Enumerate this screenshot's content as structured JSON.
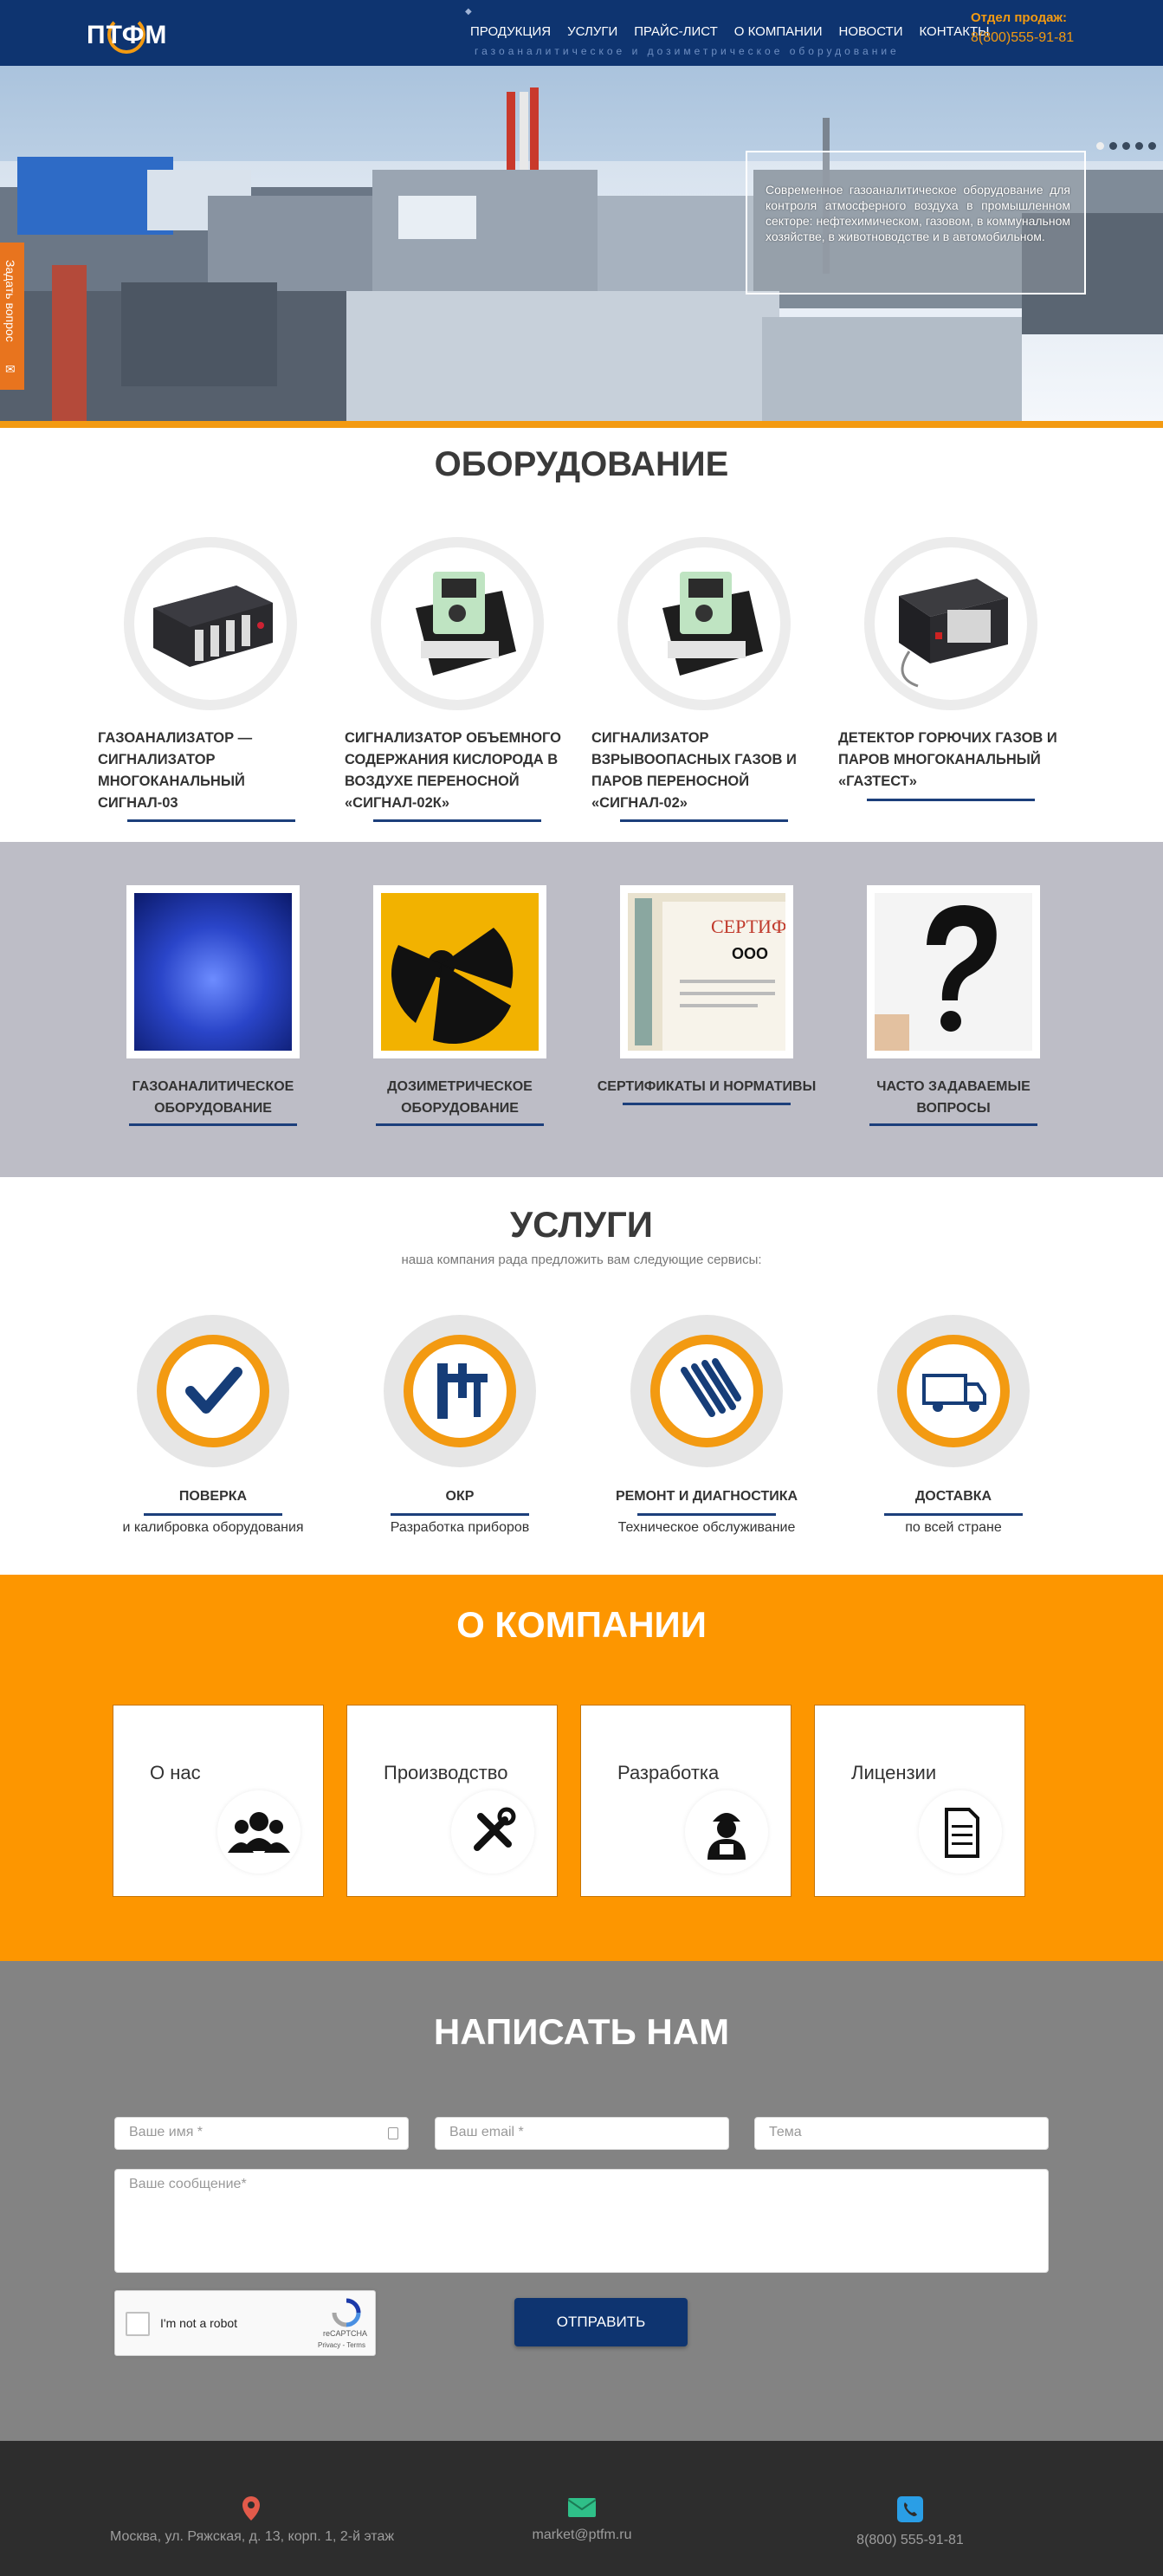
{
  "header": {
    "logo": "ПТФМ",
    "nav": [
      "ПРОДУКЦИЯ",
      "УСЛУГИ",
      "ПРАЙС-ЛИСТ",
      "О КОМПАНИИ",
      "НОВОСТИ",
      "КОНТАКТЫ"
    ],
    "tagline": "газоаналитическое и дозиметрическое оборудование",
    "sales_label": "Отдел продаж:",
    "sales_phone": "8(800)555-91-81"
  },
  "hero": {
    "text": "Современное газоаналитическое оборудование для контроля атмосферного воздуха в промышленном секторе: нефтехимическом, газовом, в коммунальном хозяйстве, в животноводстве и в автомобильном."
  },
  "ask_tab": {
    "label": "Задать вопрос"
  },
  "equipment": {
    "title": "ОБОРУДОВАНИЕ",
    "items": [
      {
        "label_lines": [
          "ГАЗОАНАЛИЗАТОР —",
          "СИГНАЛИЗАТОР",
          "МНОГОКАНАЛЬНЫЙ",
          "СИГНАЛ-03"
        ]
      },
      {
        "label_lines": [
          "СИГНАЛИЗАТОР ОБЪЕМНОГО",
          "СОДЕРЖАНИЯ КИСЛОРОДА В",
          "ВОЗДУХЕ ПЕРЕНОСНОЙ",
          "«СИГНАЛ-02К»"
        ]
      },
      {
        "label_lines": [
          "СИГНАЛИЗАТОР",
          "ВЗРЫВООПАСНЫХ ГАЗОВ И",
          "ПАРОВ ПЕРЕНОСНОЙ",
          "«СИГНАЛ-02»"
        ]
      },
      {
        "label_lines": [
          "ДЕТЕКТОР ГОРЮЧИХ ГАЗОВ И",
          "ПАРОВ МНОГОКАНАЛЬНЫЙ",
          "«ГАЗТЕСТ»"
        ]
      }
    ]
  },
  "categories": {
    "items": [
      {
        "label_lines": [
          "ГАЗОАНАЛИТИЧЕСКОЕ",
          "ОБОРУДОВАНИЕ"
        ]
      },
      {
        "label_lines": [
          "ДОЗИМЕТРИЧЕСКОЕ",
          "ОБОРУДОВАНИЕ"
        ]
      },
      {
        "label_lines": [
          "СЕРТИФИКАТЫ И НОРМАТИВЫ"
        ]
      },
      {
        "label_lines": [
          "ЧАСТО ЗАДАВАЕМЫЕ",
          "ВОПРОСЫ"
        ]
      }
    ]
  },
  "services": {
    "title": "УСЛУГИ",
    "subtitle": "наша компания рада предложить вам следующие сервисы:",
    "items": [
      {
        "title": "ПОВЕРКА",
        "sub": "и калибровка оборудования",
        "icon": "check-icon"
      },
      {
        "title": "ОКР",
        "sub": "Разработка приборов",
        "icon": "caliper-icon"
      },
      {
        "title": "РЕМОНТ И ДИАГНОСТИКА",
        "sub": "Техническое обслуживание",
        "icon": "wrench-icon"
      },
      {
        "title": "ДОСТАВКА",
        "sub": "по всей стране",
        "icon": "truck-icon"
      }
    ]
  },
  "about": {
    "title": "О КОМПАНИИ",
    "cards": [
      {
        "label": "О нас",
        "icon": "people-icon"
      },
      {
        "label": "Производство",
        "icon": "tools-icon"
      },
      {
        "label": "Разработка",
        "icon": "engineer-icon"
      },
      {
        "label": "Лицензии",
        "icon": "document-icon"
      }
    ]
  },
  "contact": {
    "title": "НАПИСАТЬ НАМ",
    "name_placeholder": "Ваше имя *",
    "email_placeholder": "Ваш email *",
    "subject_placeholder": "Тема",
    "message_placeholder": "Ваше сообщение*",
    "captcha_label": "I'm not a robot",
    "captcha_brand": "reCAPTCHA",
    "captcha_terms": "Privacy - Terms",
    "send_label": "ОТПРАВИТЬ"
  },
  "footer": {
    "address": "Москва, ул. Ряжская, д. 13, корп. 1, 2-й этаж",
    "email": "market@ptfm.ru",
    "phone": "8(800) 555-91-81"
  },
  "colors": {
    "navy": "#0e3470",
    "orange": "#f39a11",
    "about_bg": "#fd9600",
    "gray_section": "#bdbdc6",
    "contact_bg": "#838383",
    "footer_bg": "#2d2d2d"
  }
}
